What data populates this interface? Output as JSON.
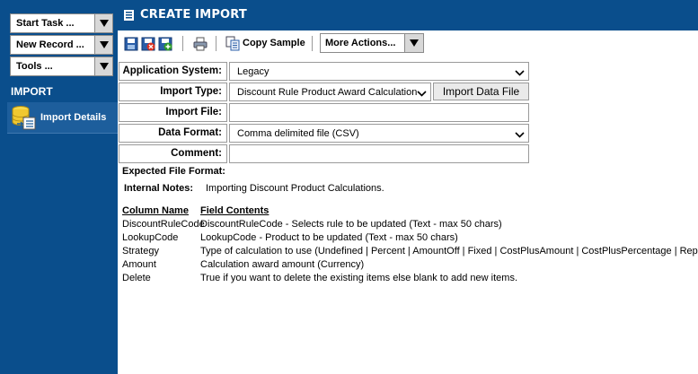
{
  "sidebar": {
    "task_selects": [
      {
        "label": "Start Task ..."
      },
      {
        "label": "New Record ..."
      },
      {
        "label": "Tools ..."
      }
    ],
    "section_title": "IMPORT",
    "items": [
      {
        "label": "Import Details"
      }
    ]
  },
  "header": {
    "title": "CREATE IMPORT"
  },
  "toolbar": {
    "copy_sample_label": "Copy Sample",
    "more_actions_label": "More Actions..."
  },
  "form": {
    "application_system": {
      "label": "Application System:",
      "value": "Legacy"
    },
    "import_type": {
      "label": "Import Type:",
      "value": "Discount Rule Product Award Calculations"
    },
    "import_button_label": "Import Data File",
    "import_file": {
      "label": "Import File:",
      "value": ""
    },
    "data_format": {
      "label": "Data Format:",
      "value": "Comma delimited file (CSV)"
    },
    "comment": {
      "label": "Comment:",
      "value": ""
    }
  },
  "info": {
    "expected_format_label": "Expected File Format:",
    "internal_notes_label": "Internal Notes:",
    "internal_notes_value": "Importing Discount Product Calculations."
  },
  "columns": {
    "header_name": "Column Name",
    "header_contents": "Field Contents",
    "rows": [
      {
        "name": "DiscountRuleCode",
        "contents": "DiscountRuleCode - Selects rule to be updated (Text - max 50 chars)"
      },
      {
        "name": "LookupCode",
        "contents": "LookupCode - Product to be updated (Text - max 50 chars)"
      },
      {
        "name": "Strategy",
        "contents": "Type of calculation to use (Undefined | Percent | AmountOff | Fixed | CostPlusAmount | CostPlusPercentage | Replace"
      },
      {
        "name": "Amount",
        "contents": "Calculation award amount (Currency)"
      },
      {
        "name": "Delete",
        "contents": "True if you want to delete the existing items else blank to add new items."
      }
    ]
  }
}
